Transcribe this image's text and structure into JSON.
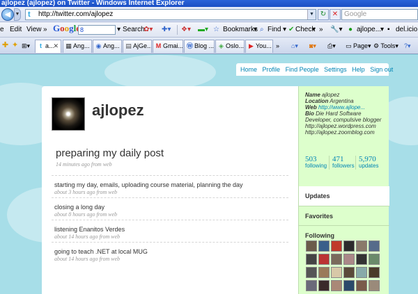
{
  "window": {
    "title": "ajlopez (ajlopez) on Twitter - Windows Internet Explorer"
  },
  "address": {
    "url": "http://twitter.com/ajlopez",
    "search_placeholder": "Google"
  },
  "google_toolbar": {
    "logo": [
      "G",
      "o",
      "o",
      "g",
      "l",
      "e"
    ],
    "search_value": "8",
    "items": [
      "Search",
      "Bookmarks",
      "Find",
      "Check",
      "ajlope...",
      "del.icio..."
    ],
    "left_items": [
      "e",
      "Edit",
      "View"
    ]
  },
  "tabs": [
    {
      "label": "a...",
      "icon": "twitter-icon",
      "active": true
    },
    {
      "label": "Ang...",
      "icon": "page-icon"
    },
    {
      "label": "Ang...",
      "icon": "page-icon"
    },
    {
      "label": "AjGe...",
      "icon": "page-icon"
    },
    {
      "label": "Gmai...",
      "icon": "gmail-icon"
    },
    {
      "label": "Blog ...",
      "icon": "blog-icon"
    },
    {
      "label": "Oslo...",
      "icon": "page-icon"
    },
    {
      "label": "You...",
      "icon": "youtube-icon"
    }
  ],
  "command_bar": {
    "page": "Page",
    "tools": "Tools"
  },
  "twitter": {
    "nav": [
      "Home",
      "Profile",
      "Find People",
      "Settings",
      "Help",
      "Sign out"
    ],
    "username": "ajlopez",
    "latest": {
      "text": "preparing my daily post",
      "meta": "14 minutes ago from web"
    },
    "tweets": [
      {
        "text": "starting my day, emails, uploading course material, planning the day",
        "meta": "about 3 hours ago from web"
      },
      {
        "text": "closing a long day",
        "meta": "about 8 hours ago from web"
      },
      {
        "text": "listening Enanitos Verdes",
        "meta": "about 14 hours ago from web"
      },
      {
        "text": "going to teach .NET at local MUG",
        "meta": "about 14 hours ago from web"
      }
    ],
    "profile": {
      "name_label": "Name",
      "name": "ajlopez",
      "location_label": "Location",
      "location": "Argentina",
      "web_label": "Web",
      "web": "http://www.ajlope...",
      "bio_label": "Bio",
      "bio": "Die Hard Software Developer, compulsive blogger",
      "bio_links": [
        "http://ajlopez.wordpress.com",
        "http://ajlopez.zoomblog.com"
      ]
    },
    "stats": [
      {
        "num": "503",
        "label": "following"
      },
      {
        "num": "471",
        "label": "followers"
      },
      {
        "num": "5,970",
        "label": "updates"
      }
    ],
    "side_menu": [
      "Updates",
      "Favorites",
      "Following"
    ]
  }
}
